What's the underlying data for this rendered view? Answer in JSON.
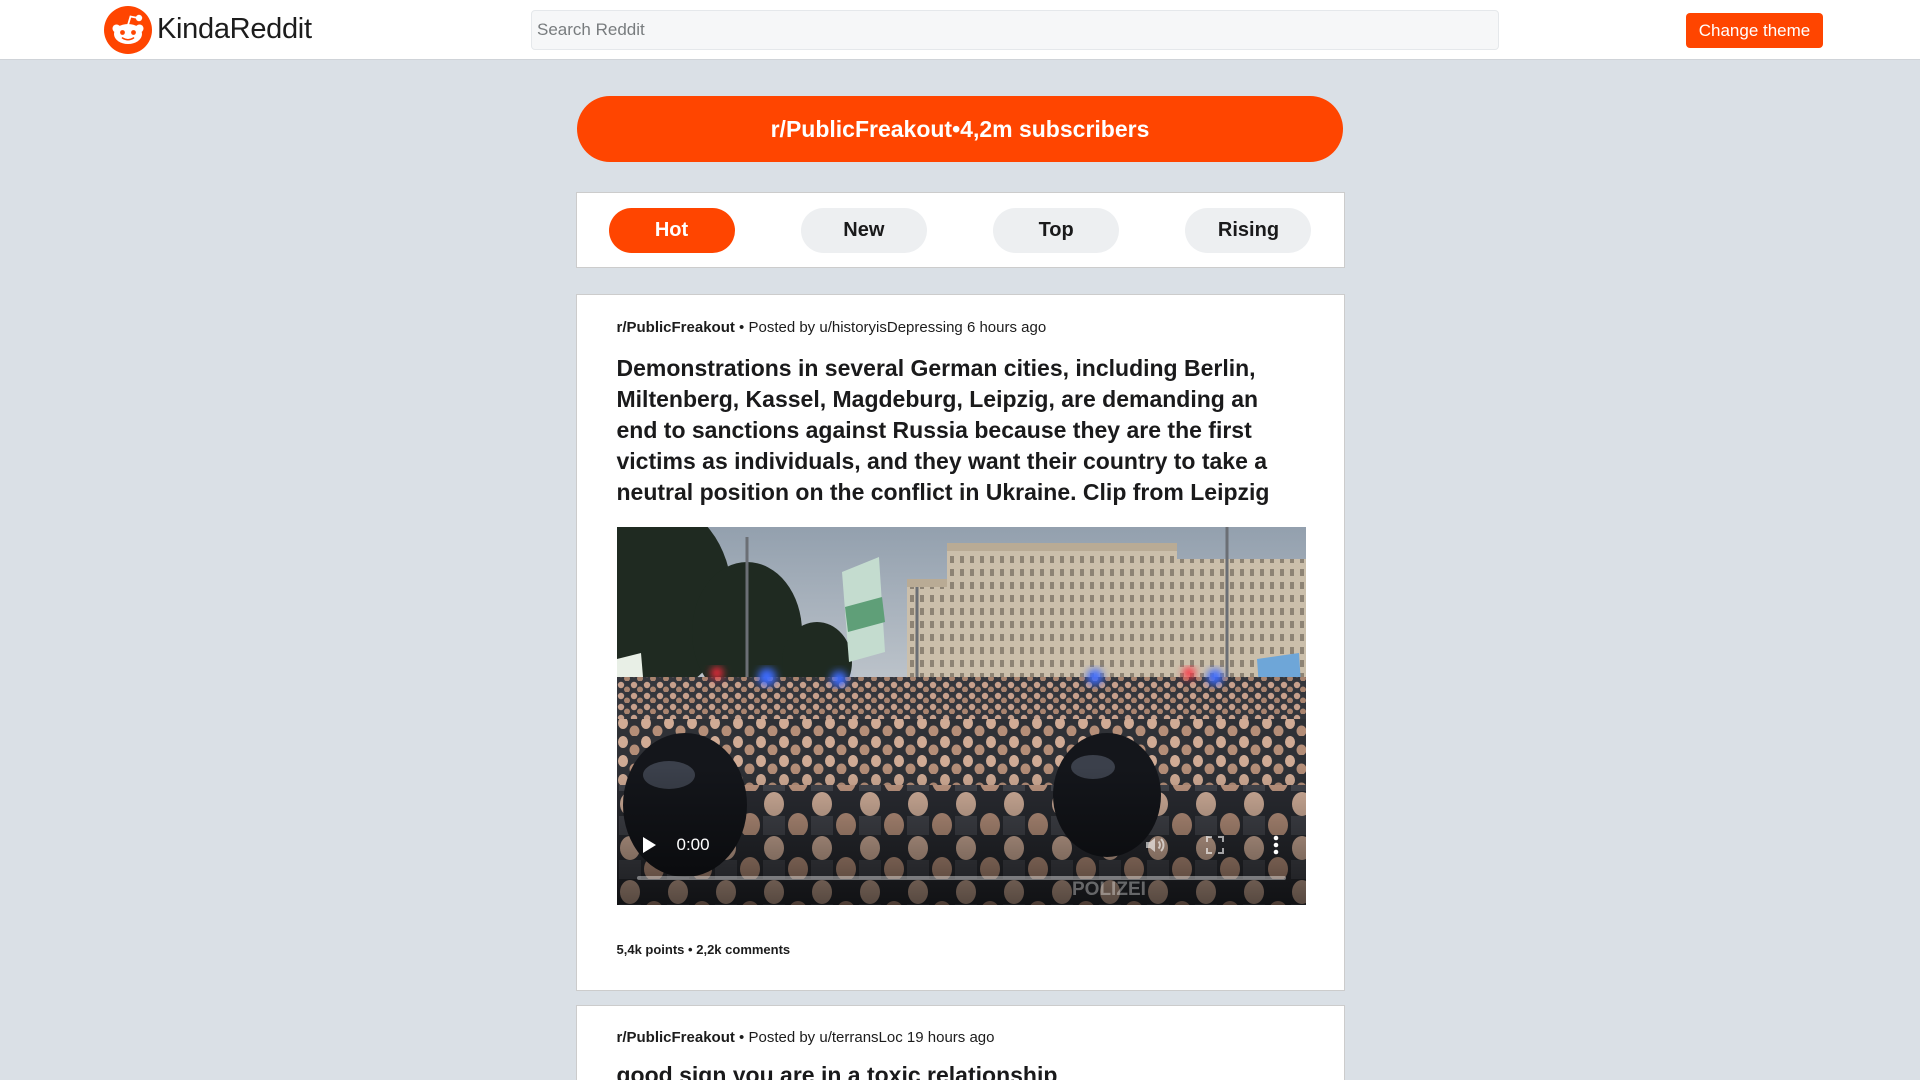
{
  "header": {
    "logo_text": "KindaReddit",
    "logo_icon": "reddit-snoo-icon",
    "search_placeholder": "Search Reddit",
    "search_value": "",
    "change_theme_label": "Change theme"
  },
  "subreddit_banner": {
    "name": "r/PublicFreakout",
    "separator": "•",
    "subscribers": "4,2m subscribers"
  },
  "sort_tabs": [
    {
      "label": "Hot",
      "active": true
    },
    {
      "label": "New",
      "active": false
    },
    {
      "label": "Top",
      "active": false
    },
    {
      "label": "Rising",
      "active": false
    }
  ],
  "posts": [
    {
      "subreddit": "r/PublicFreakout",
      "separator": "•",
      "posted_by_label": "Posted by",
      "author": "u/historyisDepressing",
      "time": "6 hours ago",
      "title": "Demonstrations in several German cities, including Berlin, Miltenberg, Kassel, Magdeburg, Leipzig, are demanding an end to sanctions against Russia because they are the first victims as individuals, and they want their country to take a neutral position on the conflict in Ukraine. Clip from Leipzig",
      "media": {
        "current_time": "0:00",
        "progress": 0,
        "frame_text": "POLIZEI",
        "controls": {
          "play_icon": "play-icon",
          "volume_icon": "volume-icon",
          "fullscreen_icon": "fullscreen-icon",
          "more_icon": "more-vertical-icon"
        }
      },
      "points": "5,4k points",
      "stats_separator": "•",
      "comments": "2,2k comments"
    },
    {
      "subreddit": "r/PublicFreakout",
      "separator": "•",
      "posted_by_label": "Posted by",
      "author": "u/terransLoc",
      "time": "19 hours ago",
      "title": "good sign you are in a toxic relationship"
    }
  ],
  "colors": {
    "accent": "#ff4500",
    "page_background": "#dae0e6",
    "card_background": "#ffffff",
    "tab_inactive": "#edeff1"
  }
}
